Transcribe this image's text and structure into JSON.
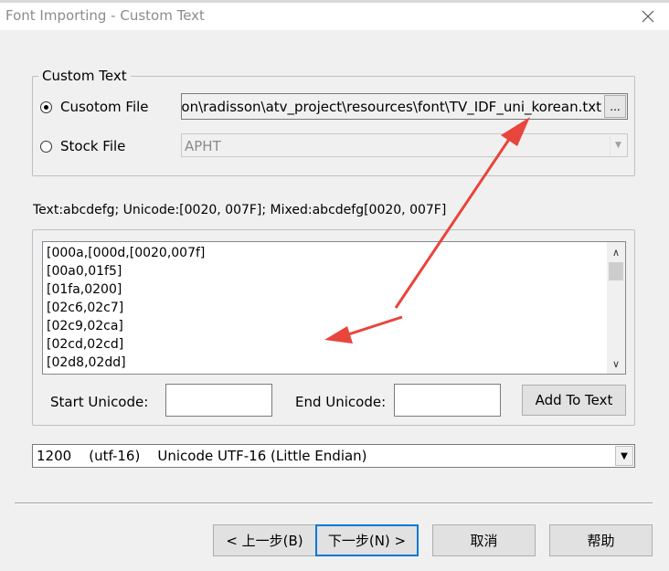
{
  "window": {
    "title": "Font Importing - Custom Text",
    "close_icon": "close-icon"
  },
  "custom_text_group": {
    "legend": "Custom Text",
    "custom_file": {
      "label": "Cusotom File",
      "selected": true,
      "path": ":ion\\radisson\\atv_project\\resources\\font\\TV_IDF_uni_korean.txt",
      "browse_label": "..."
    },
    "stock_file": {
      "label": "Stock File",
      "selected": false,
      "value": "APHT"
    }
  },
  "format_hint": "Text:abcdefg;  Unicode:[0020, 007F];  Mixed:abcdefg[0020, 007F]",
  "ranges": {
    "items": [
      "[000a,[000d,[0020,007f]",
      "[00a0,01f5]",
      "[01fa,0200]",
      "[02c6,02c7]",
      "[02c9,02ca]",
      "[02cd,02cd]",
      "[02d8,02dd]"
    ],
    "start_label": "Start Unicode:",
    "start_value": "",
    "end_label": "End Unicode:",
    "end_value": "",
    "add_button": "Add To Text"
  },
  "encoding": {
    "selected": "1200    (utf-16)    Unicode UTF-16 (Little Endian)"
  },
  "footer_buttons": {
    "prev": "< 上一步(B)",
    "next": "下一步(N) >",
    "cancel": "取消",
    "help": "帮助"
  },
  "colors": {
    "annotation_arrow": "#e8453c",
    "default_button_border": "#0078d7"
  }
}
